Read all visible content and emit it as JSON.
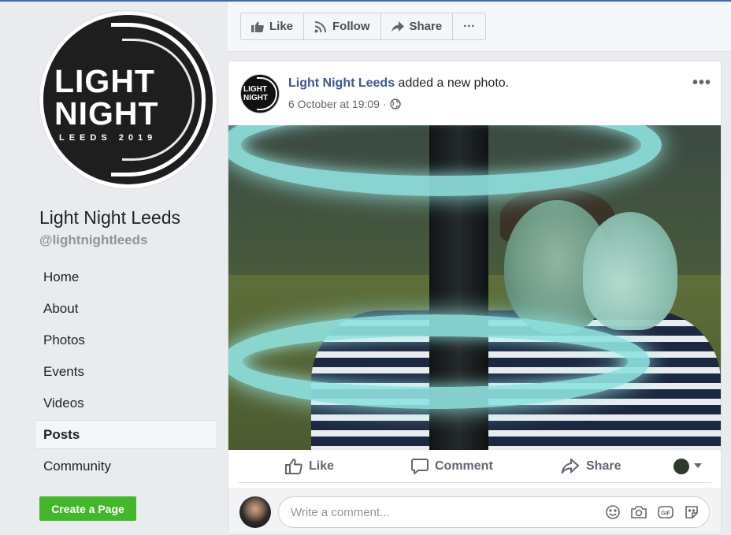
{
  "page": {
    "name": "Light Night Leeds",
    "handle": "@lightnightleeds",
    "logo": {
      "line1": "LIGHT",
      "line2": "NIGHT",
      "line3": "LEEDS 2019"
    }
  },
  "nav": {
    "items": [
      {
        "label": "Home"
      },
      {
        "label": "About"
      },
      {
        "label": "Photos"
      },
      {
        "label": "Events"
      },
      {
        "label": "Videos"
      },
      {
        "label": "Posts",
        "active": true
      },
      {
        "label": "Community"
      }
    ]
  },
  "create_page_label": "Create a Page",
  "top_actions": {
    "like": "Like",
    "follow": "Follow",
    "share": "Share",
    "more": "···"
  },
  "post": {
    "author": "Light Night Leeds",
    "action_text": " added a new photo.",
    "timestamp": "6 October at 19:09",
    "separator": "·",
    "more": "•••",
    "avatar_text": {
      "line1": "LIGHT",
      "line2": "NIGHT"
    }
  },
  "reactions": {
    "like": "Like",
    "comment": "Comment",
    "share": "Share"
  },
  "comment_box": {
    "placeholder": "Write a comment..."
  },
  "colors": {
    "accent": "#4267b2",
    "link": "#385898",
    "create_button": "#42b72a",
    "background": "#e9ebee"
  }
}
